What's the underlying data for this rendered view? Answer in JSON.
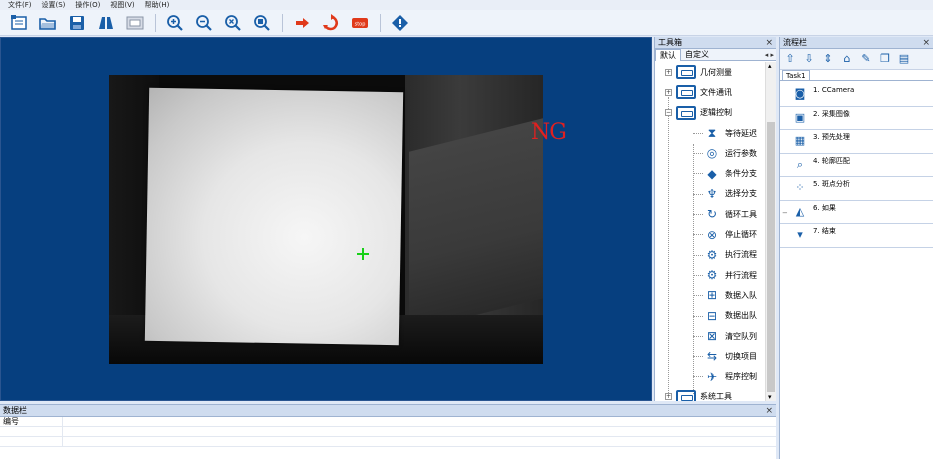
{
  "menubar": {
    "items": [
      "文件(F)",
      "设置(S)",
      "操作(O)",
      "视图(V)",
      "帮助(H)"
    ]
  },
  "toolbar": {
    "buttons": [
      "new-doc-icon",
      "open-folder-icon",
      "save-icon",
      "binoculars-icon",
      "image-frame-icon",
      "zoom-in-icon",
      "zoom-out-icon",
      "zoom-fit-icon",
      "zoom-reset-icon",
      "run-once-icon",
      "loop-run-icon",
      "stop-icon",
      "info-icon"
    ],
    "stop_label": "stop"
  },
  "display": {
    "result_text": "NG"
  },
  "toolbox": {
    "title": "工具箱",
    "close": "×",
    "tabs": [
      "默认",
      "自定义"
    ],
    "tab_arrows": "◂ ▸",
    "categories": [
      {
        "label": "几何测量",
        "expander": "+"
      },
      {
        "label": "文件通讯",
        "expander": "+"
      },
      {
        "label": "逻辑控制",
        "expander": "−"
      }
    ],
    "logic_children": [
      "等待延迟",
      "运行参数",
      "条件分支",
      "选择分支",
      "循环工具",
      "停止循环",
      "执行流程",
      "并行流程",
      "数据入队",
      "数据出队",
      "清空队列",
      "切换项目",
      "程序控制"
    ],
    "bottom_category": {
      "label": "系统工具",
      "expander": "+"
    }
  },
  "flow": {
    "title": "流程栏",
    "close": "×",
    "tab": "Task1",
    "steps": [
      {
        "label": "1. CCamera",
        "icon": "camera-icon"
      },
      {
        "label": "2. 采集图像",
        "icon": "capture-image-icon"
      },
      {
        "label": "3. 预先处理",
        "icon": "preprocess-icon"
      },
      {
        "label": "4. 轮廓匹配",
        "icon": "contour-match-icon"
      },
      {
        "label": "5. 斑点分析",
        "icon": "blob-analysis-icon"
      },
      {
        "label": "6. 如果",
        "icon": "if-icon",
        "expander": "−"
      },
      {
        "label": "7. 结束",
        "icon": "end-icon"
      }
    ]
  },
  "datapanel": {
    "title": "数据栏",
    "close": "×",
    "header": "编号"
  },
  "colors": {
    "display_bg": "#063f7f",
    "ng_red": "#e02020",
    "crosshair_green": "#18d018"
  }
}
